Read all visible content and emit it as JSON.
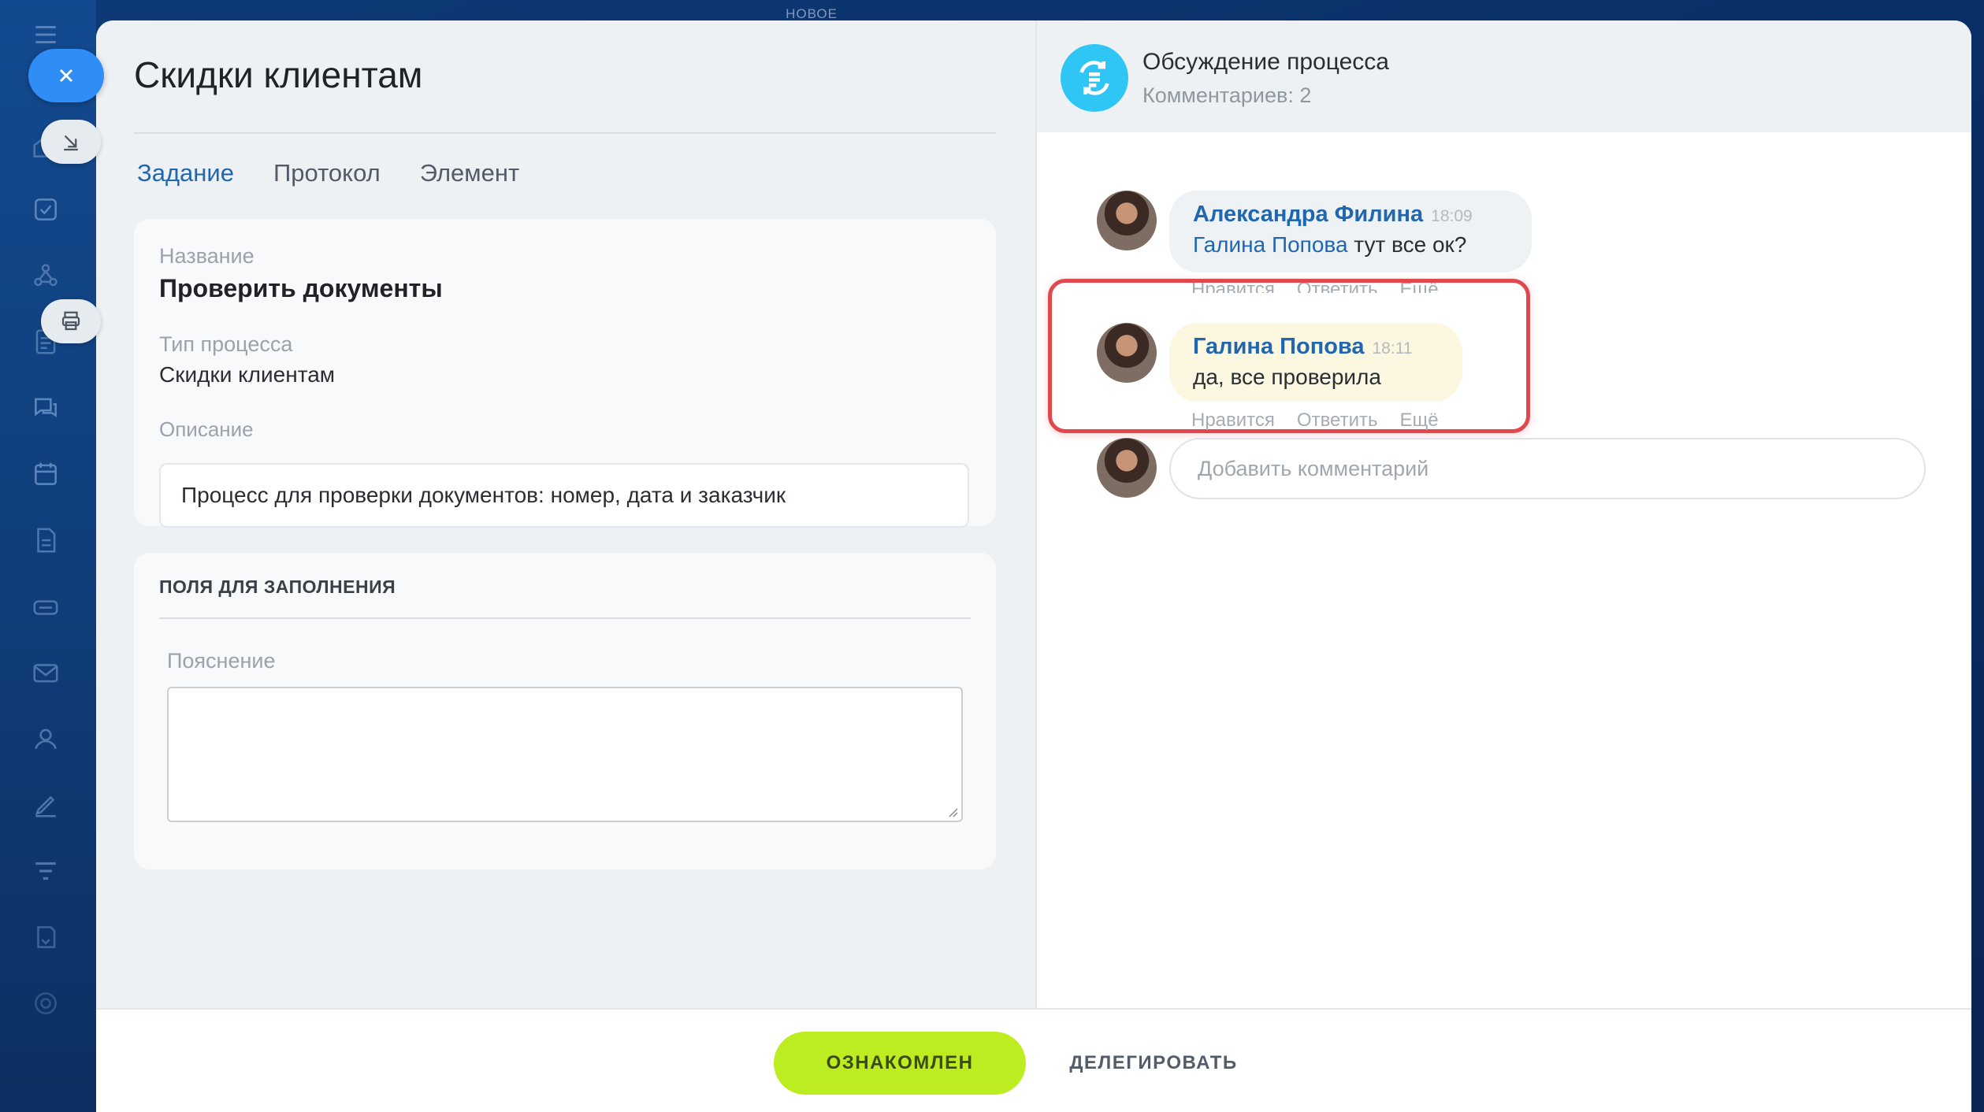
{
  "top_label": "НОВОЕ",
  "task": {
    "title": "Скидки клиентам",
    "tabs": [
      {
        "label": "Задание",
        "active": true
      },
      {
        "label": "Протокол",
        "active": false
      },
      {
        "label": "Элемент",
        "active": false
      }
    ],
    "fields": {
      "name_label": "Название",
      "name_value": "Проверить документы",
      "type_label": "Тип процесса",
      "type_value": "Скидки клиентам",
      "desc_label": "Описание",
      "desc_value": "Процесс для проверки документов: номер, дата и заказчик"
    },
    "fill_section": {
      "heading": "ПОЛЯ ДЛЯ ЗАПОЛНЕНИЯ",
      "field_label": "Пояснение",
      "field_value": ""
    }
  },
  "discussion": {
    "title": "Обсуждение процесса",
    "count": "Комментариев: 2",
    "comments": [
      {
        "author": "Александра Филина",
        "time": "18:09",
        "mention": "Галина Попова",
        "text": " тут все ок?",
        "actions": [
          "Нравится",
          "Ответить",
          "Ещё"
        ]
      },
      {
        "author": "Галина Попова",
        "time": "18:11",
        "text": "да, все проверила",
        "actions": [
          "Нравится",
          "Ответить",
          "Ещё"
        ],
        "highlighted": true
      }
    ],
    "add_placeholder": "Добавить комментарий"
  },
  "footer": {
    "primary": "ОЗНАКОМЛЕН",
    "secondary": "ДЕЛЕГИРОВАТЬ"
  },
  "colors": {
    "accent_blue": "#2067b0",
    "primary_button": "#bbed21",
    "highlight_border": "#e0484e",
    "discussion_icon": "#2fc6f6"
  }
}
